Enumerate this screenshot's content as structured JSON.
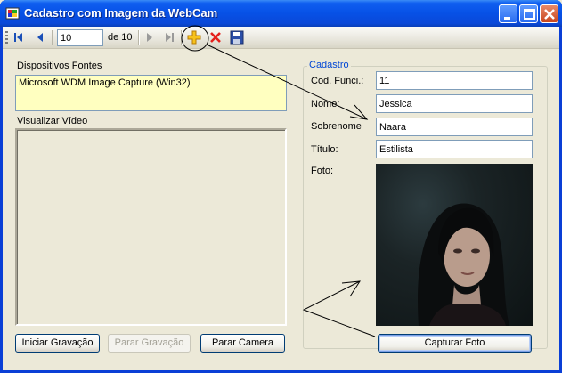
{
  "window": {
    "title": "Cadastro com Imagem da WebCam"
  },
  "navigator": {
    "position": "10",
    "count_label": "de 10"
  },
  "devices": {
    "label": "Dispositivos Fontes",
    "items": [
      "Microsoft WDM Image Capture (Win32)"
    ]
  },
  "video": {
    "label": "Visualizar Vídeo"
  },
  "buttons": {
    "start_recording": "Iniciar Gravação",
    "stop_recording": "Parar Gravação",
    "stop_camera": "Parar Camera",
    "capture_photo": "Capturar Foto"
  },
  "form": {
    "group_title": "Cadastro",
    "code_label": "Cod. Funci.:",
    "code_value": "11",
    "name_label": "Nome:",
    "name_value": "Jessica",
    "surname_label": "Sobrenome",
    "surname_value": "Naara",
    "title_label": "Título:",
    "title_value": "Estilista",
    "photo_label": "Foto:"
  },
  "colors": {
    "titlebar": "#0751e6",
    "listbox_bg": "#ffffc0",
    "group_title": "#0046d5"
  },
  "icons": [
    "move-first-icon",
    "move-previous-icon",
    "move-next-icon",
    "move-last-icon",
    "add-new-icon",
    "delete-icon",
    "save-icon"
  ]
}
